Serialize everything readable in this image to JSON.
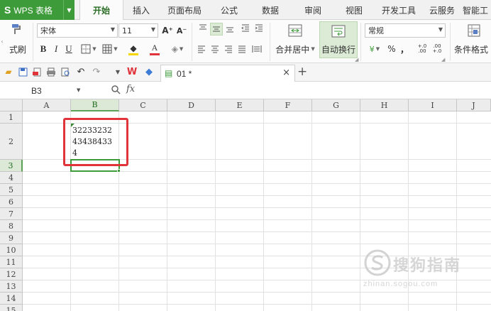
{
  "app": {
    "logo": "S",
    "name": "WPS 表格"
  },
  "ribbon_tabs": [
    "开始",
    "插入",
    "页面布局",
    "公式",
    "数据",
    "审阅",
    "视图",
    "开发工具",
    "云服务",
    "智能工"
  ],
  "active_tab": "开始",
  "ribbon": {
    "format_painter_label": "式刷",
    "font_name": "宋体",
    "font_size": "11",
    "grow_font": "A⁺",
    "shrink_font": "A⁻",
    "bold": "B",
    "italic": "I",
    "underline": "U",
    "merge_center_label": "合并居中",
    "wrap_text_label": "自动换行",
    "number_format": "常规",
    "percent": "%",
    "comma": "，",
    "inc_decimal": "+.0 .00",
    "dec_decimal": ".00 +.0",
    "conditional_format_label": "条件格式",
    "accent_color": "#3d9b3a",
    "font_color_bar": "#e0343a",
    "fill_color_bar": "#f7d600"
  },
  "document_tab": {
    "name": "01 *",
    "close": "×",
    "new_tab": "+"
  },
  "formula_bar": {
    "cell_ref": "B3",
    "fx": "fx",
    "value": ""
  },
  "columns": [
    "A",
    "B",
    "C",
    "D",
    "E",
    "F",
    "G",
    "H",
    "I",
    "J"
  ],
  "rows": [
    "1",
    "2",
    "3",
    "4",
    "5",
    "6",
    "7",
    "8",
    "9",
    "10",
    "11",
    "12",
    "13",
    "14",
    "15"
  ],
  "selected_column": "B",
  "selected_row": "3",
  "cells": {
    "B2": {
      "lines": [
        "32233232",
        "43438433",
        "4"
      ]
    }
  },
  "annotation": {
    "color": "#e0343a"
  },
  "watermark": {
    "text": "搜狗指南",
    "url": "zhinan.sogou.com"
  }
}
